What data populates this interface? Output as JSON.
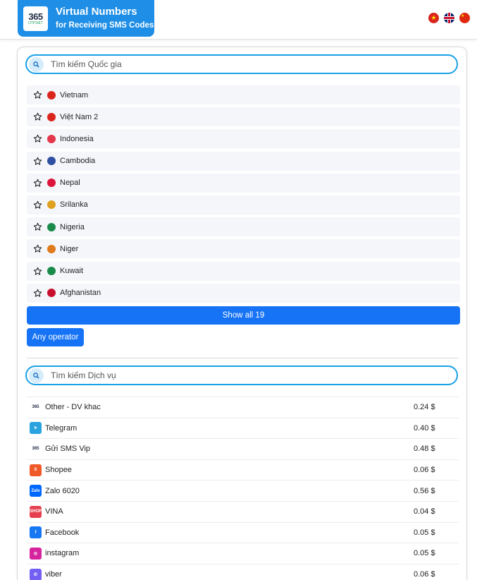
{
  "header": {
    "logo_number": "365",
    "logo_sub": "OTP.NET",
    "title": "Virtual Numbers",
    "subtitle": "for Receiving SMS Codes",
    "languages": [
      "vi",
      "en",
      "zh"
    ]
  },
  "country_search": {
    "placeholder": "Tìm kiếm Quốc gia"
  },
  "countries": [
    {
      "name": "Vietnam",
      "flag_color": "#da251d"
    },
    {
      "name": "Việt Nam 2",
      "flag_color": "#da251d"
    },
    {
      "name": "Indonesia",
      "flag_color": "#e4374c"
    },
    {
      "name": "Cambodia",
      "flag_color": "#2f4fa3"
    },
    {
      "name": "Nepal",
      "flag_color": "#dc143c"
    },
    {
      "name": "Srilanka",
      "flag_color": "#e0a020"
    },
    {
      "name": "Nigeria",
      "flag_color": "#1a8a4a"
    },
    {
      "name": "Niger",
      "flag_color": "#e07b1c"
    },
    {
      "name": "Kuwait",
      "flag_color": "#1a8a4a"
    },
    {
      "name": "Afghanistan",
      "flag_color": "#c8102e"
    }
  ],
  "show_all_label": "Show all 19",
  "operator_label": "Any operator",
  "service_search": {
    "placeholder": "Tìm kiếm Dịch vụ"
  },
  "services": [
    {
      "name": "Other - DV khac",
      "price": "0.24 $",
      "icon": "365-logo-icon",
      "color": "#ffffff",
      "glyph": "365"
    },
    {
      "name": "Telegram",
      "price": "0.40 $",
      "icon": "telegram-icon",
      "color": "#2aa3de",
      "glyph": "➤"
    },
    {
      "name": "Gửi SMS Vip",
      "price": "0.48 $",
      "icon": "365-logo-icon",
      "color": "#ffffff",
      "glyph": "365"
    },
    {
      "name": "Shopee",
      "price": "0.06 $",
      "icon": "shopee-icon",
      "color": "#f05a28",
      "glyph": "S"
    },
    {
      "name": "Zalo 6020",
      "price": "0.56 $",
      "icon": "zalo-icon",
      "color": "#0068ff",
      "glyph": "Zalo"
    },
    {
      "name": "VINA",
      "price": "0.04 $",
      "icon": "vina-icon",
      "color": "#e5404f",
      "glyph": "SHOP"
    },
    {
      "name": "Facebook",
      "price": "0.05 $",
      "icon": "facebook-icon",
      "color": "#1877f2",
      "glyph": "f"
    },
    {
      "name": "instagram",
      "price": "0.05 $",
      "icon": "instagram-icon",
      "color": "#d6249f",
      "glyph": "◎"
    },
    {
      "name": "viber",
      "price": "0.06 $",
      "icon": "viber-icon",
      "color": "#7360f2",
      "glyph": "✆"
    }
  ]
}
